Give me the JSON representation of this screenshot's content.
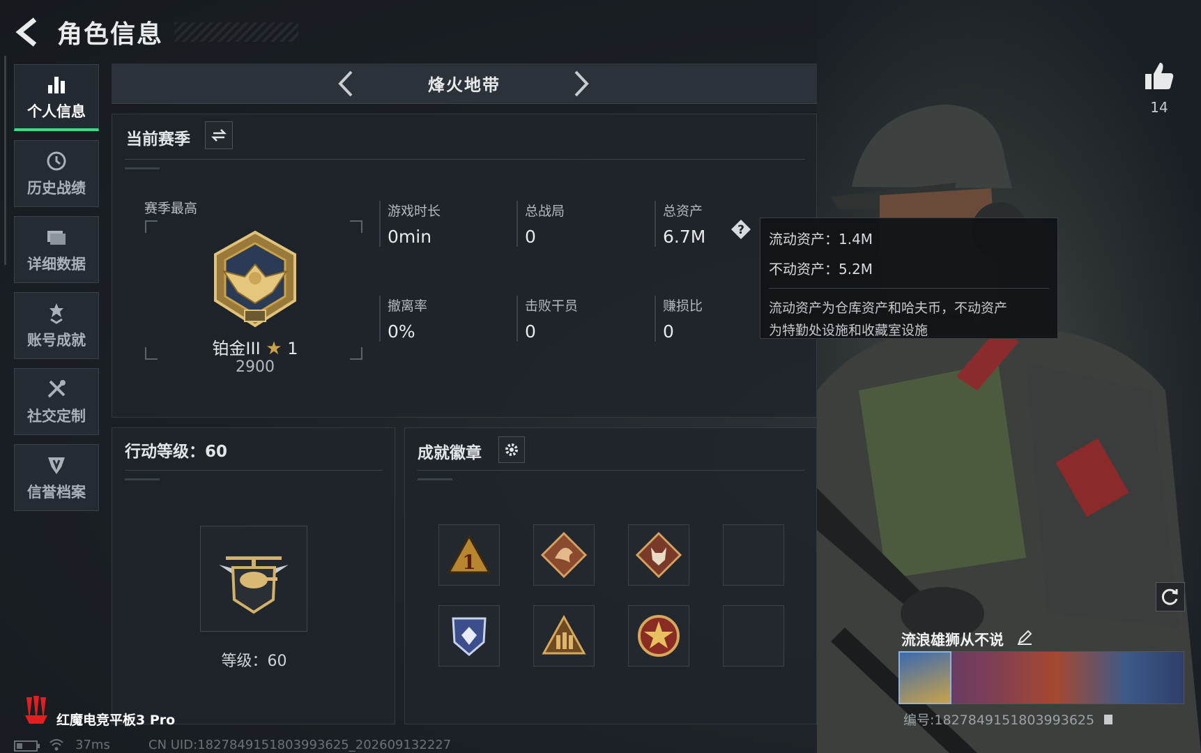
{
  "header": {
    "title": "角色信息"
  },
  "sidebar": {
    "items": [
      {
        "label": "个人信息",
        "icon": "bar-chart-icon",
        "active": true
      },
      {
        "label": "历史战绩",
        "icon": "history-icon"
      },
      {
        "label": "详细数据",
        "icon": "folder-icon"
      },
      {
        "label": "账号成就",
        "icon": "achievement-icon"
      },
      {
        "label": "社交定制",
        "icon": "tools-icon"
      },
      {
        "label": "信誉档案",
        "icon": "shield-icon"
      }
    ]
  },
  "map_selector": {
    "name": "烽火地带"
  },
  "season": {
    "title": "当前赛季",
    "best_label": "赛季最高",
    "rank_name": "铂金III",
    "rank_stars": "1",
    "rank_points": "2900",
    "stats": [
      {
        "label": "游戏时长",
        "value": "0min"
      },
      {
        "label": "总战局",
        "value": "0"
      },
      {
        "label": "总资产",
        "value": "6.7M"
      },
      {
        "label": "撤离率",
        "value": "0%"
      },
      {
        "label": "击败干员",
        "value": "0"
      },
      {
        "label": "赚损比",
        "value": "0"
      }
    ]
  },
  "tooltip": {
    "liquid": "流动资产：1.4M",
    "fixed": "不动资产：5.2M",
    "desc_line1": "流动资产为仓库资产和哈夫币，不动资产",
    "desc_line2": "为特勤处设施和收藏室设施"
  },
  "level": {
    "title": "行动等级：60",
    "text": "等级：60"
  },
  "badges": {
    "title": "成就徽章",
    "slots": [
      {
        "icon": "rank-one-triangle-icon"
      },
      {
        "icon": "dragon-diamond-icon"
      },
      {
        "icon": "wolf-diamond-icon"
      },
      {
        "icon": "empty-slot"
      },
      {
        "icon": "crystal-shield-icon"
      },
      {
        "icon": "soldiers-triangle-icon"
      },
      {
        "icon": "star-medal-icon"
      },
      {
        "icon": "empty-slot"
      }
    ]
  },
  "profile": {
    "likes": "14",
    "name": "流浪雄狮从不说",
    "id": "编号:1827849151803993625"
  },
  "footer": {
    "brand": "红魔电竞平板3 Pro",
    "ping": "37ms",
    "uid": "CN UID:1827849151803993625_202609132227"
  },
  "colors": {
    "accent": "#3ddc84",
    "gold": "#c9a24a",
    "background": "#1a1f25"
  }
}
